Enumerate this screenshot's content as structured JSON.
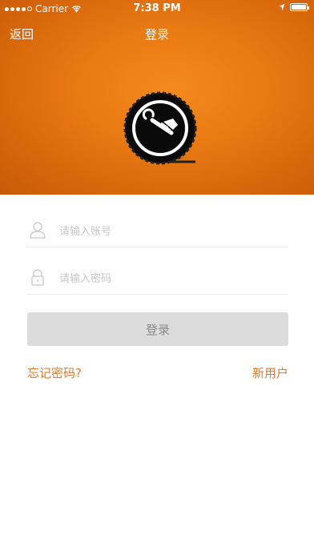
{
  "status_bar": {
    "carrier": "Carrier",
    "time": "7:38 PM",
    "battery_level": 1.0
  },
  "nav": {
    "back_label": "返回",
    "title": "登录"
  },
  "form": {
    "username_placeholder": "请输入账号",
    "password_placeholder": "请输入密码",
    "login_label": "登录"
  },
  "links": {
    "forgot_password": "忘记密码?",
    "new_user": "新用户"
  },
  "colors": {
    "brand_orange": "#e8782a",
    "button_gray": "#dcdcdc"
  },
  "icons": [
    "wifi-icon",
    "battery-icon",
    "wrench-logo-icon",
    "user-icon",
    "lock-icon"
  ]
}
